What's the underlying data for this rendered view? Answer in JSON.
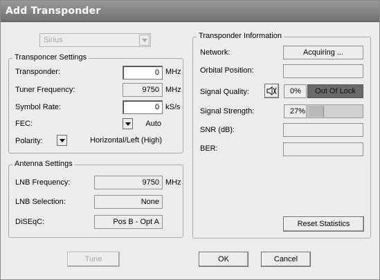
{
  "window": {
    "title": "Add Transponder"
  },
  "satellite_select": {
    "value": "Sirius"
  },
  "transponder_settings": {
    "legend": "Transponcer Settings",
    "transponder": {
      "label": "Transponder:",
      "value": "0",
      "unit": "MHz"
    },
    "tuner_frequency": {
      "label": "Tuner Frequency:",
      "value": "9750",
      "unit": "MHz"
    },
    "symbol_rate": {
      "label": "Symbol Rate:",
      "value": "0",
      "unit": "kS/s"
    },
    "fec": {
      "label": "FEC:",
      "value": "Auto"
    },
    "polarity": {
      "label": "Polarity:",
      "value": "Horizontal/Left (High)"
    }
  },
  "antenna_settings": {
    "legend": "Antenna Settings",
    "lnb_frequency": {
      "label": "LNB Frequency:",
      "value": "9750",
      "unit": "MHz"
    },
    "lnb_selection": {
      "label": "LNB Selection:",
      "value": "None"
    },
    "diseqc": {
      "label": "DiSEqC:",
      "value": "Pos B - Opt A"
    }
  },
  "transponder_info": {
    "legend": "Transponder Information",
    "network": {
      "label": "Network:",
      "value": "Acquiring ..."
    },
    "orbital_position": {
      "label": "Orbital Position:",
      "value": ""
    },
    "signal_quality": {
      "label": "Signal Quality:",
      "percent_text": "0%",
      "status": "Out Of Lock",
      "level": 0
    },
    "signal_strength": {
      "label": "Signal Strength:",
      "percent_text": "27%",
      "level": 0.27
    },
    "snr": {
      "label": "SNR (dB):",
      "value": ""
    },
    "ber": {
      "label": "BER:",
      "value": ""
    },
    "reset_button": "Reset Statistics"
  },
  "buttons": {
    "tune": "Tune",
    "ok": "OK",
    "cancel": "Cancel"
  },
  "colors": {
    "titlebar": "#7f7f7f",
    "status_dark": "#6a6a6a",
    "meter_fill": "#b8b8b8"
  },
  "icons": {
    "signal_audio": "speaker-icon"
  }
}
